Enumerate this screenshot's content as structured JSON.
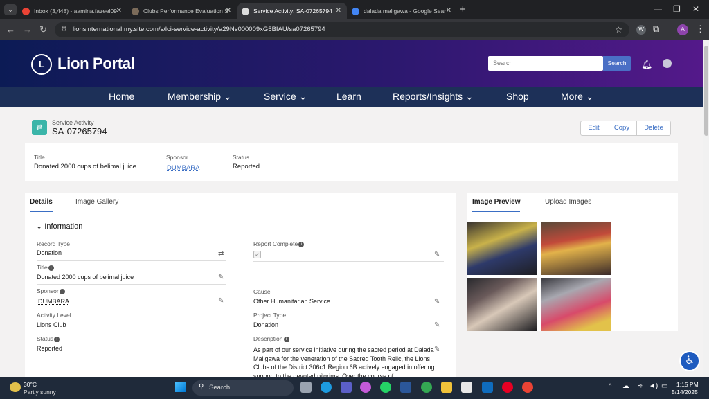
{
  "browser": {
    "tabs": [
      {
        "title": "Inbox (3,448) - aamina.fazeel09",
        "favicon_color": "#ea4335"
      },
      {
        "title": "Clubs Performance Evaluation S",
        "favicon_color": "#7b6b5a"
      },
      {
        "title": "Service Activity: SA-07265794",
        "favicon_color": "#dddddd"
      },
      {
        "title": "dalada maligawa - Google Sear",
        "favicon_color": "#4285f4"
      }
    ],
    "url": "lionsinternational.my.site.com/s/lci-service-activity/a29Ns000009xG5BIAU/sa07265794",
    "profile_initial": "A"
  },
  "header": {
    "brand": "Lion Portal",
    "logo_text": "L",
    "search_placeholder": "Search",
    "search_button": "Search"
  },
  "nav": {
    "items": [
      "Home",
      "Membership ⌄",
      "Service ⌄",
      "Learn",
      "Reports/Insights ⌄",
      "Shop",
      "More ⌄"
    ]
  },
  "record": {
    "object_label": "Service Activity",
    "name": "SA-07265794",
    "buttons": [
      "Edit",
      "Copy",
      "Delete"
    ]
  },
  "highlights": {
    "title_label": "Title",
    "title_value": "Donated 2000 cups of belimal juice",
    "sponsor_label": "Sponsor",
    "sponsor_value": "DUMBARA",
    "status_label": "Status",
    "status_value": "Reported"
  },
  "details": {
    "tabs": [
      "Details",
      "Image Gallery"
    ],
    "section": "Information",
    "fields": {
      "record_type_label": "Record Type",
      "record_type_value": "Donation",
      "report_complete_label": "Report Complete",
      "report_complete_checked": true,
      "title_label": "Title",
      "title_value": "Donated 2000 cups of belimal juice",
      "sponsor_label": "Sponsor",
      "sponsor_value": "DUMBARA",
      "cause_label": "Cause",
      "cause_value": "Other Humanitarian Service",
      "activity_level_label": "Activity Level",
      "activity_level_value": "Lions Club",
      "project_type_label": "Project Type",
      "project_type_value": "Donation",
      "status_label": "Status",
      "status_value": "Reported",
      "description_label": "Description",
      "description_value": "As part of our service initiative during the sacred period at Dalada Maligawa for the veneration of the Sacred Tooth Relic, the Lions Clubs of the District 306c1 Region 6B actively engaged in offering support to the devoted pilgrims. Over the course of"
    }
  },
  "images": {
    "tabs": [
      "Image Preview",
      "Upload Images"
    ]
  },
  "taskbar": {
    "temperature": "30°C",
    "condition": "Partly sunny",
    "search_placeholder": "Search",
    "time": "1:15 PM",
    "date": "5/14/2025"
  }
}
